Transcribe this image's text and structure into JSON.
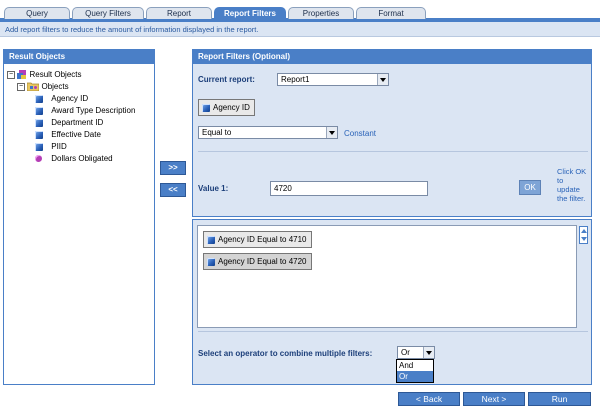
{
  "tabs": [
    {
      "label": "Query"
    },
    {
      "label": "Query Filters"
    },
    {
      "label": "Report"
    },
    {
      "label": "Report Filters",
      "active": true
    },
    {
      "label": "Properties"
    },
    {
      "label": "Format"
    }
  ],
  "info_text": "Add report filters to reduce the amount of information displayed in the report.",
  "result_objects": {
    "header": "Result Objects",
    "root_label": "Result Objects",
    "folder_label": "Objects",
    "items": [
      {
        "label": "Agency ID",
        "icon": "dimension-cube-icon"
      },
      {
        "label": "Award Type Description",
        "icon": "dimension-cube-icon"
      },
      {
        "label": "Department ID",
        "icon": "dimension-cube-icon"
      },
      {
        "label": "Effective Date",
        "icon": "dimension-cube-icon"
      },
      {
        "label": "PIID",
        "icon": "dimension-cube-icon"
      },
      {
        "label": "Dollars Obligated",
        "icon": "measure-dot-icon"
      }
    ]
  },
  "move_buttons": {
    "add": ">>",
    "remove": "<<"
  },
  "report_filters": {
    "header": "Report Filters (Optional)",
    "current_report_label": "Current report:",
    "current_report_value": "Report1",
    "object_button": "Agency ID",
    "operator_value": "Equal to",
    "constant_link": "Constant",
    "value1_label": "Value 1:",
    "value1": "4720",
    "ok_label": "OK",
    "hint": [
      "Click OK",
      "to",
      "update",
      "the filter."
    ],
    "filters": [
      {
        "label": "Agency ID Equal to 4710",
        "selected": false
      },
      {
        "label": "Agency ID Equal to 4720",
        "selected": true
      }
    ],
    "combine_label": "Select an operator to combine multiple filters:",
    "combine_value": "Or",
    "combine_options": [
      "And",
      "Or"
    ],
    "combine_highlighted": "Or"
  },
  "nav": {
    "back": "< Back",
    "next": "Next >",
    "run": "Run"
  },
  "colors": {
    "accent": "#4a7fc7",
    "panel_bg": "#dbe5f3"
  }
}
